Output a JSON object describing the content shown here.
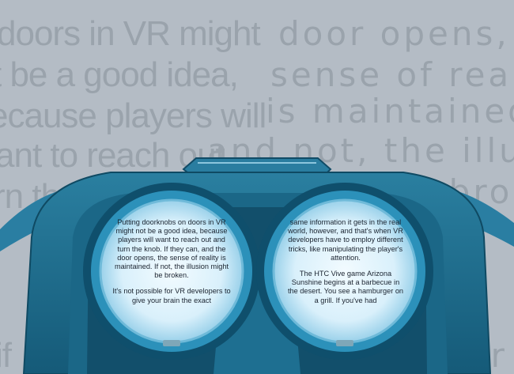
{
  "background_text": {
    "left_lines": [
      "doors in VR might",
      "t be a good idea,",
      "ecause players will",
      "ant to reach out",
      "rn the knob. If",
      "if"
    ],
    "right_lines": [
      "door opens, th",
      "sense of realit",
      "is maintained. I",
      "and not, the illusion",
      "t be broken.",
      "ur"
    ]
  },
  "left_lens": {
    "paragraph1": "Putting doorknobs on doors in VR might not be a good idea, because players will want to reach out and turn the knob. If they can, and the door opens, the sense of reality is maintained. If not, the illusion might be broken.",
    "paragraph2": "It's not possible for VR developers to give your brain the exact"
  },
  "right_lens": {
    "paragraph1": "same information it gets in the real world, however, and that's when VR developers have to employ different tricks, like manipulating the player's attention.",
    "paragraph2": "The HTC Vive game Arizona Sunshine begins at a barbecue in the desert. You see a hamburger on a grill. If you've had"
  },
  "colors": {
    "background": "#b4bcc5",
    "headset": "#1f6f8f",
    "headset_dark": "#0e4a64",
    "lens_glow": "#cfe9f6"
  }
}
